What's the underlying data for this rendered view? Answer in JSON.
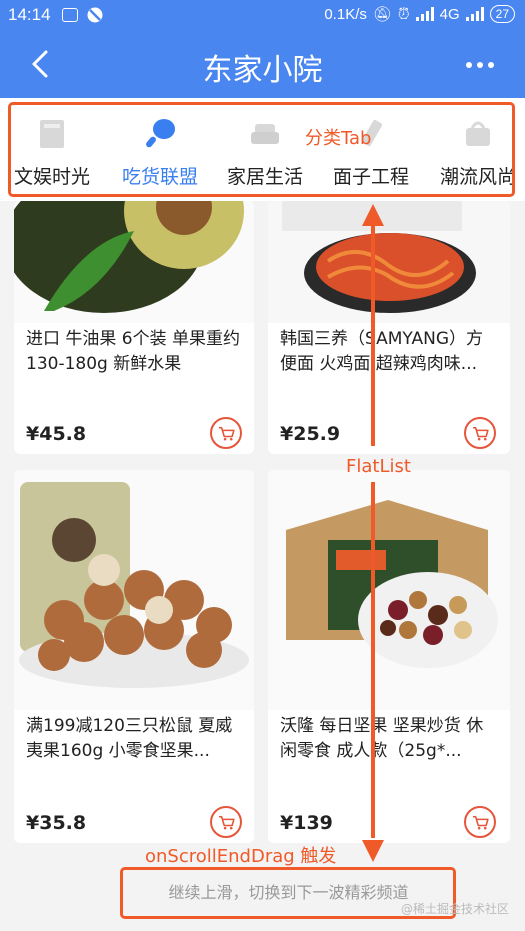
{
  "status_bar": {
    "time": "14:14",
    "network_speed": "0.1K/s",
    "signal": "4G",
    "battery": "27"
  },
  "header": {
    "title": "东家小院"
  },
  "tabs": [
    {
      "label": "文娱时光",
      "icon": "entertainment-icon",
      "active": false
    },
    {
      "label": "吃货联盟",
      "icon": "chicken-leg-icon",
      "active": true
    },
    {
      "label": "家居生活",
      "icon": "sofa-icon",
      "active": false
    },
    {
      "label": "面子工程",
      "icon": "cosmetics-icon",
      "active": false
    },
    {
      "label": "潮流风尚",
      "icon": "bag-icon",
      "active": false
    }
  ],
  "products": [
    {
      "name": "进口 牛油果 6个装 单果重约130-180g 新鲜水果",
      "price": "¥45.8"
    },
    {
      "name": "韩国三养（SAMYANG）方便面 火鸡面 超辣鸡肉味...",
      "price": "¥25.9"
    },
    {
      "name": "满199减120三只松鼠 夏威夷果160g 小零食坚果...",
      "price": "¥35.8"
    },
    {
      "name": "沃隆 每日坚果 坚果炒货 休闲零食 成人款（25g*...",
      "price": "¥139"
    }
  ],
  "annotations": {
    "tab_label": "分类Tab",
    "list_label": "FlatList",
    "scroll_label": "onScrollEndDrag 触发"
  },
  "footer_hint": "继续上滑，切换到下一波精彩频道",
  "watermark": "@稀土掘金技术社区",
  "colors": {
    "primary": "#4a86f0",
    "active_tab": "#3a7ff0",
    "annotation": "#f05a28",
    "cart": "#e6553a"
  }
}
